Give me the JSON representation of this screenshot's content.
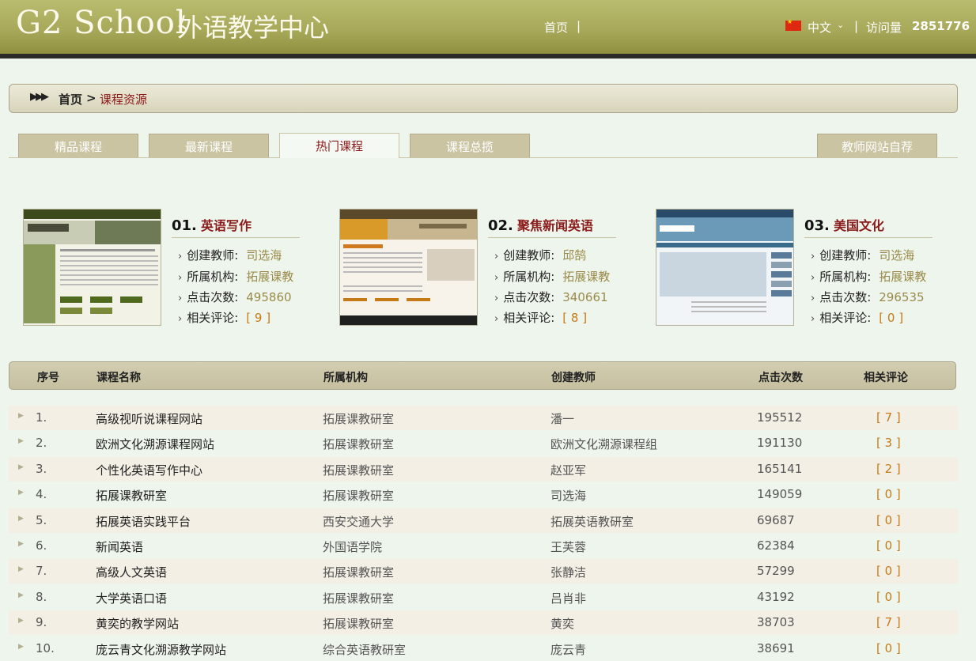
{
  "header": {
    "logo_main": "G2 School",
    "logo_sub": "外语教学中心",
    "nav_home": "首页",
    "separator": "|",
    "language": "中文",
    "visits_label": "访问量",
    "visits_value": "2851776"
  },
  "breadcrumb": {
    "home": "首页",
    "gt": ">",
    "current": "课程资源"
  },
  "tabs": [
    {
      "label": "精品课程"
    },
    {
      "label": "最新课程"
    },
    {
      "label": "热门课程"
    },
    {
      "label": "课程总揽"
    },
    {
      "label": "教师网站自荐"
    }
  ],
  "featured_labels": {
    "teacher": "创建教师:",
    "org": "所属机构:",
    "clicks": "点击次数:",
    "comments": "相关评论:"
  },
  "featured": [
    {
      "num": "01.",
      "name": "英语写作",
      "teacher": "司选海",
      "org": "拓展课教",
      "clicks": "495860",
      "comments": "[ 9 ]"
    },
    {
      "num": "02.",
      "name": "聚焦新闻英语",
      "teacher": "邱鹄",
      "org": "拓展课教",
      "clicks": "340661",
      "comments": "[ 8 ]"
    },
    {
      "num": "03.",
      "name": "美国文化",
      "teacher": "司选海",
      "org": "拓展课教",
      "clicks": "296535",
      "comments": "[ 0 ]"
    }
  ],
  "table": {
    "headers": [
      "序号",
      "课程名称",
      "所属机构",
      "创建教师",
      "点击次数",
      "相关评论"
    ],
    "rows": [
      {
        "no": "1.",
        "name": "高级视听说课程网站",
        "org": "拓展课教研室",
        "teacher": "潘一",
        "clicks": "195512",
        "comments": "[ 7 ]"
      },
      {
        "no": "2.",
        "name": "欧洲文化溯源课程网站",
        "org": "拓展课教研室",
        "teacher": "欧洲文化溯源课程组",
        "clicks": "191130",
        "comments": "[ 3 ]"
      },
      {
        "no": "3.",
        "name": "个性化英语写作中心",
        "org": "拓展课教研室",
        "teacher": "赵亚军",
        "clicks": "165141",
        "comments": "[ 2 ]"
      },
      {
        "no": "4.",
        "name": "拓展课教研室",
        "org": "拓展课教研室",
        "teacher": "司选海",
        "clicks": "149059",
        "comments": "[ 0 ]"
      },
      {
        "no": "5.",
        "name": "拓展英语实践平台",
        "org": "西安交通大学",
        "teacher": "拓展英语教研室",
        "clicks": "69687",
        "comments": "[ 0 ]"
      },
      {
        "no": "6.",
        "name": "新闻英语",
        "org": "外国语学院",
        "teacher": "王芙蓉",
        "clicks": "62384",
        "comments": "[ 0 ]"
      },
      {
        "no": "7.",
        "name": "高级人文英语",
        "org": "拓展课教研室",
        "teacher": "张静洁",
        "clicks": "57299",
        "comments": "[ 0 ]"
      },
      {
        "no": "8.",
        "name": "大学英语口语",
        "org": "拓展课教研室",
        "teacher": "吕肖非",
        "clicks": "43192",
        "comments": "[ 0 ]"
      },
      {
        "no": "9.",
        "name": "黄奕的教学网站",
        "org": "拓展课教研室",
        "teacher": "黄奕",
        "clicks": "38703",
        "comments": "[ 7 ]"
      },
      {
        "no": "10.",
        "name": "庞云青文化溯源教学网站",
        "org": "综合英语教研室",
        "teacher": "庞云青",
        "clicks": "38691",
        "comments": "[ 0 ]"
      }
    ]
  }
}
